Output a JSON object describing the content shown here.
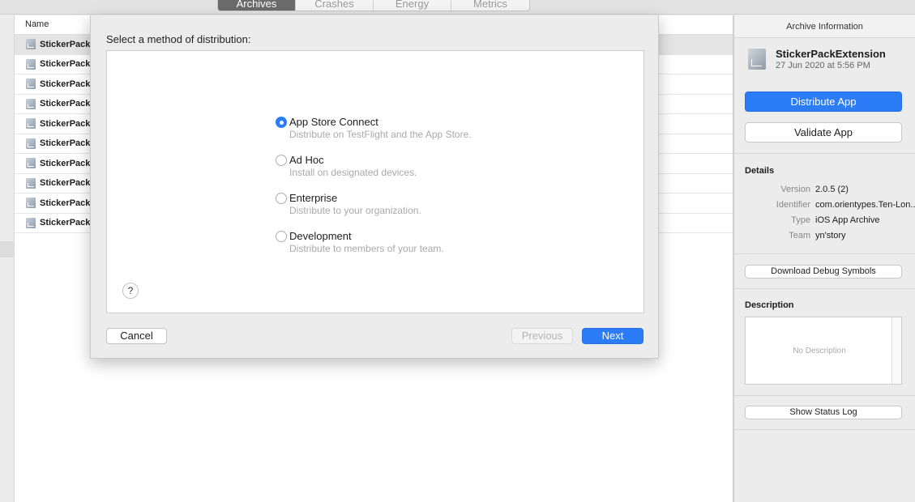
{
  "tabs": [
    "Archives",
    "Crashes",
    "Energy",
    "Metrics"
  ],
  "list": {
    "column_header": "Name",
    "rows": [
      "StickerPackEx",
      "StickerPackEx",
      "StickerPackEx",
      "StickerPackEx",
      "StickerPackEx",
      "StickerPackEx",
      "StickerPackEx",
      "StickerPackEx",
      "StickerPackEx",
      "StickerPackEx"
    ]
  },
  "sheet": {
    "title": "Select a method of distribution:",
    "options": [
      {
        "title": "App Store Connect",
        "description": "Distribute on TestFlight and the App Store.",
        "selected": true
      },
      {
        "title": "Ad Hoc",
        "description": "Install on designated devices.",
        "selected": false
      },
      {
        "title": "Enterprise",
        "description": "Distribute to your organization.",
        "selected": false
      },
      {
        "title": "Development",
        "description": "Distribute to members of your team.",
        "selected": false
      }
    ],
    "help_label": "?",
    "cancel_label": "Cancel",
    "previous_label": "Previous",
    "next_label": "Next"
  },
  "inspector": {
    "header": "Archive Information",
    "archive_name": "StickerPackExtension",
    "archive_date": "27 Jun 2020 at 5:56 PM",
    "distribute_label": "Distribute App",
    "validate_label": "Validate App",
    "details_label": "Details",
    "details": [
      {
        "key": "Version",
        "value": "2.0.5 (2)"
      },
      {
        "key": "Identifier",
        "value": "com.orientypes.Ten-Lon..."
      },
      {
        "key": "Type",
        "value": "iOS App Archive"
      },
      {
        "key": "Team",
        "value": "yn'story"
      }
    ],
    "download_symbols_label": "Download Debug Symbols",
    "description_label": "Description",
    "description_placeholder": "No Description",
    "status_log_label": "Show Status Log"
  },
  "colors": {
    "accent": "#2b7cf6"
  }
}
